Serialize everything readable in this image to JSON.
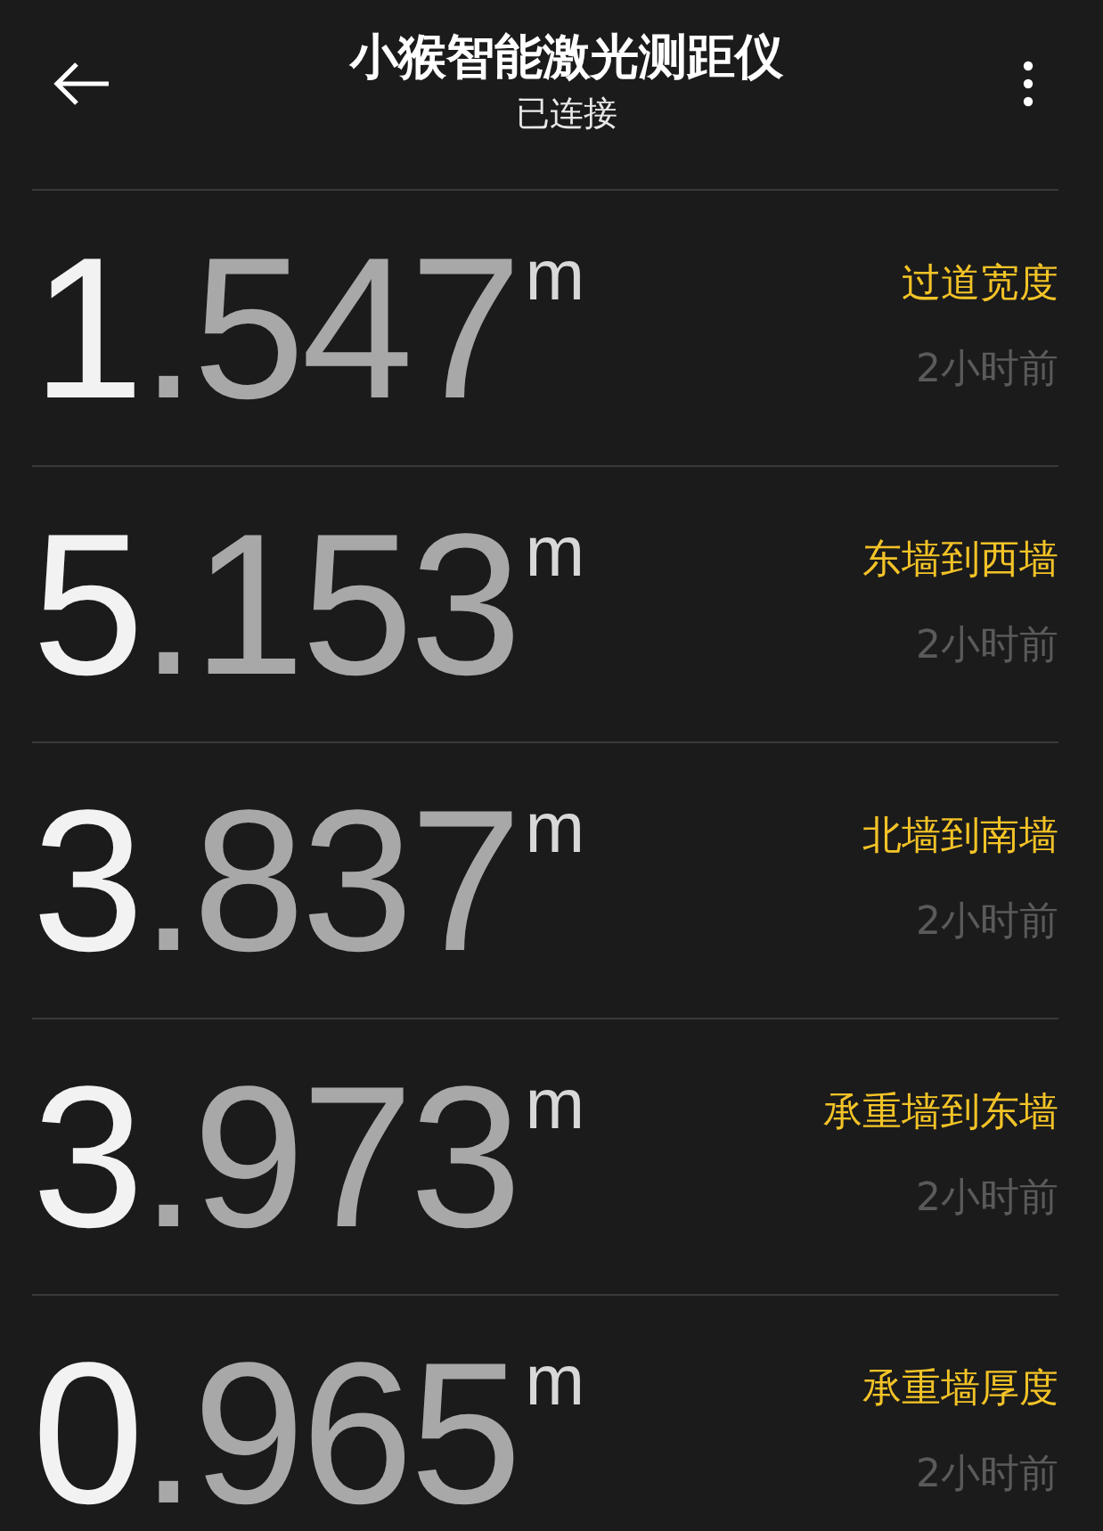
{
  "header": {
    "title": "小猴智能激光测距仪",
    "subtitle": "已连接"
  },
  "measurements": [
    {
      "value": "1.547",
      "unit": "m",
      "label": "过道宽度",
      "time": "2小时前"
    },
    {
      "value": "5.153",
      "unit": "m",
      "label": "东墙到西墙",
      "time": "2小时前"
    },
    {
      "value": "3.837",
      "unit": "m",
      "label": "北墙到南墙",
      "time": "2小时前"
    },
    {
      "value": "3.973",
      "unit": "m",
      "label": "承重墙到东墙",
      "time": "2小时前"
    },
    {
      "value": "0.965",
      "unit": "m",
      "label": "承重墙厚度",
      "time": "2小时前"
    }
  ]
}
